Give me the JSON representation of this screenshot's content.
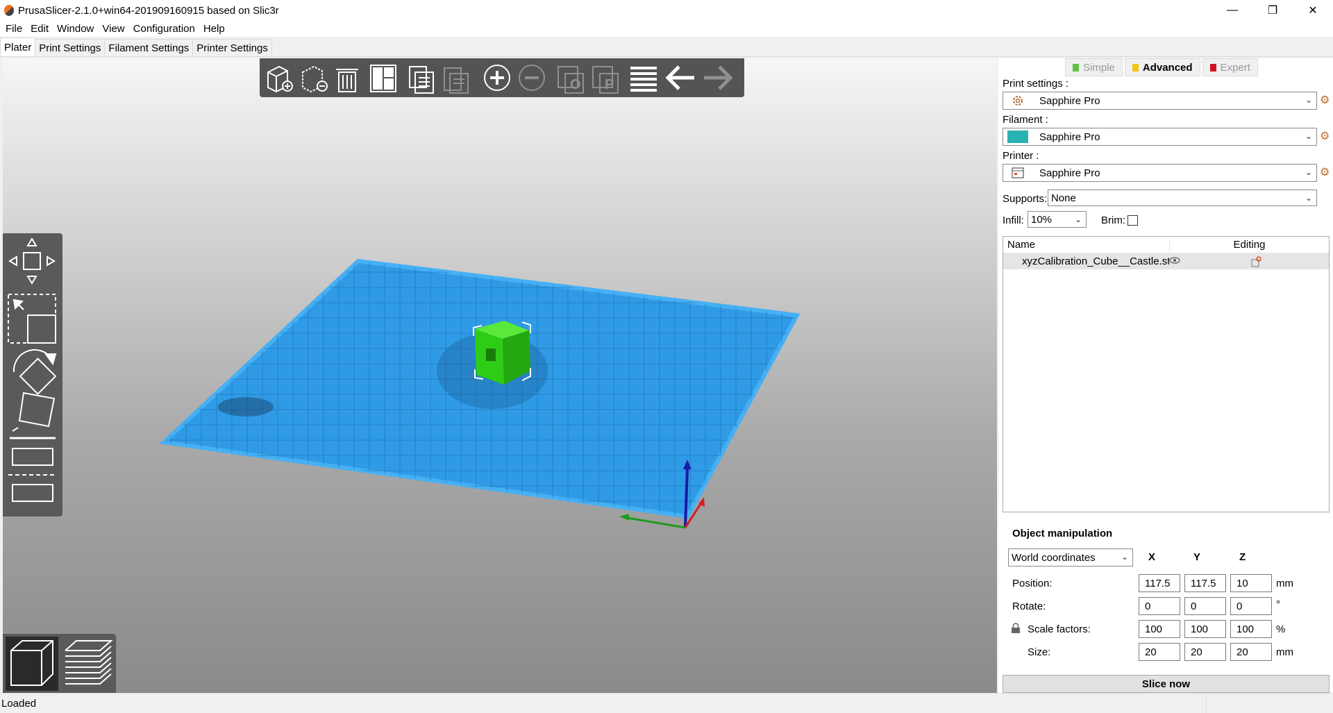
{
  "window": {
    "title": "PrusaSlicer-2.1.0+win64-201909160915 based on Slic3r",
    "minimize_glyph": "—",
    "restore_glyph": "❐",
    "close_glyph": "✕"
  },
  "menu": [
    "File",
    "Edit",
    "Window",
    "View",
    "Configuration",
    "Help"
  ],
  "tabs": [
    "Plater",
    "Print Settings",
    "Filament Settings",
    "Printer Settings"
  ],
  "active_tab": "Plater",
  "toolbar": {
    "icons": [
      "add-icon",
      "delete-icon",
      "delete-all-icon",
      "arrange-icon",
      "copy-icon",
      "paste-icon",
      "add-instance-icon",
      "remove-instance-icon",
      "split-objects-icon",
      "split-parts-icon",
      "layers-editing-icon",
      "undo-icon",
      "redo-icon"
    ]
  },
  "gizmos": [
    "move-icon",
    "scale-icon",
    "rotate-icon",
    "place-on-face-icon",
    "cut-icon"
  ],
  "views": [
    "3d-view-icon",
    "preview-icon"
  ],
  "modes": [
    {
      "label": "Simple",
      "color": "#5ec240",
      "active": false
    },
    {
      "label": "Advanced",
      "color": "#f0c814",
      "active": true
    },
    {
      "label": "Expert",
      "color": "#d0141e",
      "active": false
    }
  ],
  "presets": {
    "print_label": "Print settings :",
    "print_value": "Sapphire Pro",
    "filament_label": "Filament :",
    "filament_value": "Sapphire Pro",
    "filament_color": "#29b2b2",
    "printer_label": "Printer :",
    "printer_value": "Sapphire Pro"
  },
  "supports": {
    "label": "Supports:",
    "value": "None"
  },
  "infill": {
    "label": "Infill:",
    "value": "10%"
  },
  "brim": {
    "label": "Brim:",
    "checked": false
  },
  "object_list": {
    "col_name": "Name",
    "col_editing": "Editing",
    "rows": [
      {
        "name": "xyzCalibration_Cube__Castle.stl"
      }
    ]
  },
  "object_manipulation": {
    "title": "Object manipulation",
    "coordinates": "World coordinates",
    "axes": [
      "X",
      "Y",
      "Z"
    ],
    "rows": [
      {
        "label": "Position:",
        "values": [
          "117.5",
          "117.5",
          "10"
        ],
        "unit": "mm"
      },
      {
        "label": "Rotate:",
        "values": [
          "0",
          "0",
          "0"
        ],
        "unit": "°"
      },
      {
        "label": "Scale factors:",
        "values": [
          "100",
          "100",
          "100"
        ],
        "unit": "%"
      },
      {
        "label": "Size:",
        "values": [
          "20",
          "20",
          "20"
        ],
        "unit": "mm"
      }
    ]
  },
  "slice_button": "Slice now",
  "status": "Loaded",
  "colors": {
    "bed": "#2f9be6",
    "object": "#2ecc17",
    "axis_x": "#d02020",
    "axis_y": "#1f9a1f",
    "axis_z": "#1a1aa8"
  }
}
